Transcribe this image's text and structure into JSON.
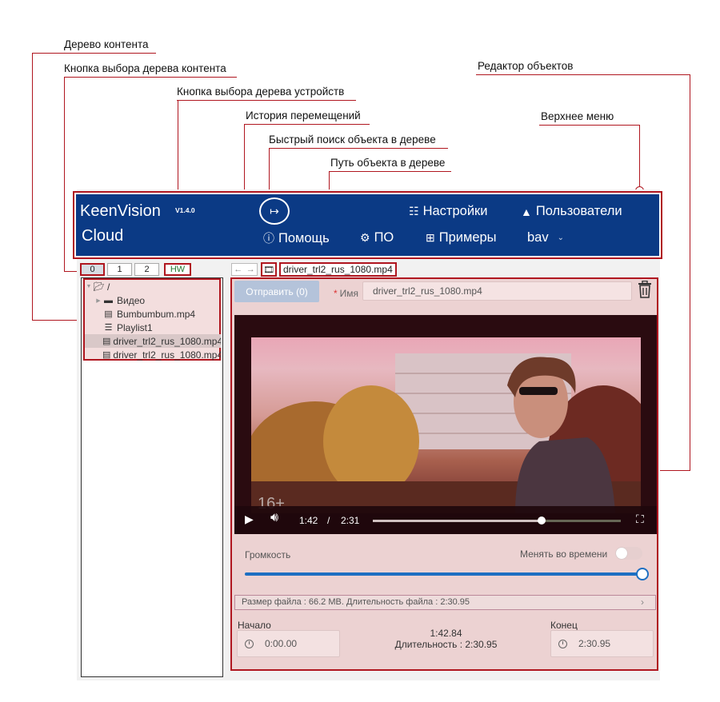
{
  "annotations": {
    "content_tree": "Дерево контента",
    "content_tree_button": "Кнопка выбора дерева контента",
    "device_tree_button": "Кнопка выбора дерева устройств",
    "history": "История перемещений",
    "quick_search": "Быстрый поиск объекта в дереве",
    "object_path": "Путь объекта в дереве",
    "object_editor": "Редактор объектов",
    "top_menu": "Верхнее меню"
  },
  "app": {
    "logo_line1": "KeenVision",
    "logo_line2": "Cloud",
    "version": "V1.4.0",
    "menu": {
      "settings": "Настройки",
      "users": "Пользователи",
      "help": "Помощь",
      "software": "ПО",
      "examples": "Примеры",
      "user": "bav"
    }
  },
  "tree_tabs": [
    "0",
    "1",
    "2",
    "HW"
  ],
  "path": "driver_trl2_rus_1080.mp4",
  "tree": [
    {
      "label": "/",
      "icon": "folder-open-icon"
    },
    {
      "label": "Видео",
      "icon": "folder-icon"
    },
    {
      "label": "Bumbumbum.mp4",
      "icon": "film-icon"
    },
    {
      "label": "Playlist1",
      "icon": "list-icon"
    },
    {
      "label": "driver_trl2_rus_1080.mp4",
      "icon": "film-icon"
    },
    {
      "label": "driver_trl2_rus_1080.mp4",
      "icon": "film-icon"
    }
  ],
  "editor": {
    "send_button": "Отправить (0)",
    "name_label": "Имя",
    "name_value": "driver_trl2_rus_1080.mp4",
    "player": {
      "current_time": "1:42",
      "separator": "/",
      "duration": "2:31",
      "progress": 0.68
    },
    "volume_label": "Громкость",
    "volume_level": 1.0,
    "change_over_time_label": "Менять во времени",
    "file_info": "Размер файла : 66.2 MB. Длительность файла : 2:30.95",
    "start_label": "Начало",
    "start_value": "0:00.00",
    "end_label": "Конец",
    "end_value": "2:30.95",
    "position_value": "1:42.84",
    "duration_text": "Длительность : 2:30.95"
  },
  "colors": {
    "accent_red": "#b0161f",
    "menu_blue": "#0b3a85",
    "slider_blue": "#1d6fc2"
  }
}
